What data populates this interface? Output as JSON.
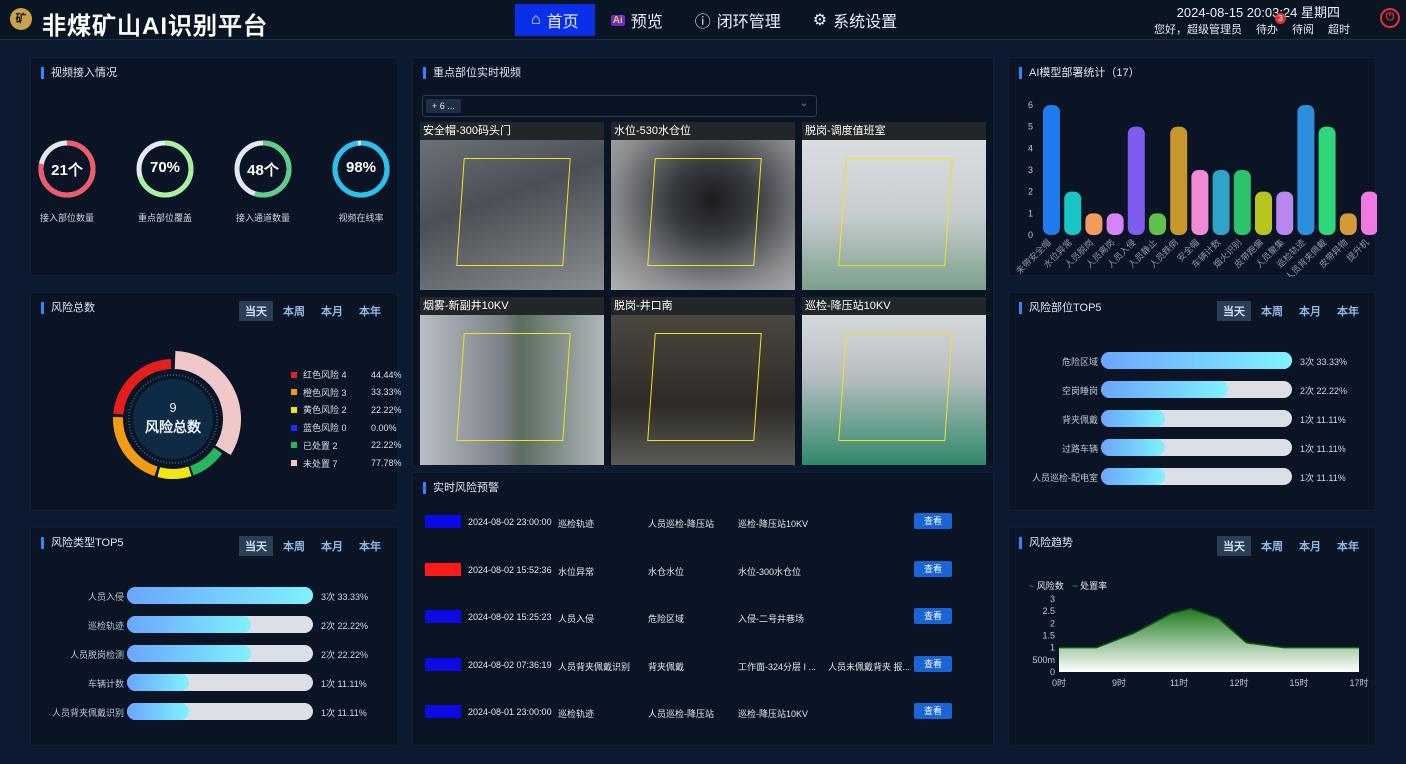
{
  "header": {
    "logo_text": "矿",
    "title": "非煤矿山AI识别平台",
    "nav": [
      {
        "label": "首页",
        "icon": "home-icon",
        "active": true
      },
      {
        "label": "预览",
        "icon": "ai-icon",
        "active": false
      },
      {
        "label": "闭环管理",
        "icon": "alert-icon",
        "active": false
      },
      {
        "label": "系统设置",
        "icon": "gear-icon",
        "active": false
      }
    ],
    "datetime": "2024-08-15 20:03:24 星期四",
    "greeting": "您好，超级管理员",
    "todo": "待办",
    "todo_badge": "3",
    "pending_read": "待阅",
    "overtime": "超时",
    "power_icon": "power-icon"
  },
  "video_access": {
    "title": "视频接入情况",
    "stats": [
      {
        "value": "21个",
        "label": "接入部位数量",
        "pct": 0.78,
        "color": "#ef5b6b"
      },
      {
        "value": "70%",
        "label": "重点部位覆盖",
        "pct": 0.7,
        "color": "#a6f0a0"
      },
      {
        "value": "48个",
        "label": "接入通道数量",
        "pct": 0.55,
        "color": "#5cd08a"
      },
      {
        "value": "98%",
        "label": "视频在线率",
        "pct": 0.98,
        "color": "#28c1f0"
      }
    ]
  },
  "risk_total": {
    "title": "风险总数",
    "tabs": [
      "当天",
      "本周",
      "本月",
      "本年"
    ],
    "active_tab": "当天",
    "center_value": "9",
    "center_label": "风险总数",
    "legend": [
      {
        "label": "红色风险 4",
        "pct": "44.44%",
        "color": "#e51d1d",
        "value": 4
      },
      {
        "label": "橙色风险 3",
        "pct": "33.33%",
        "color": "#f39c12",
        "value": 3
      },
      {
        "label": "黄色风险 2",
        "pct": "22.22%",
        "color": "#f5e50f",
        "value": 2
      },
      {
        "label": "蓝色风险 0",
        "pct": "0.00%",
        "color": "#1a2bff",
        "value": 0
      },
      {
        "label": "已处置 2",
        "pct": "22.22%",
        "color": "#27b55e",
        "value": 2
      },
      {
        "label": "未处置 7",
        "pct": "77.78%",
        "color": "#f0c8c8",
        "value": 7
      }
    ]
  },
  "risk_type_top5": {
    "title": "风险类型TOP5",
    "tabs": [
      "当天",
      "本周",
      "本月",
      "本年"
    ],
    "active_tab": "当天",
    "items": [
      {
        "label": "人员入侵",
        "count": "3次",
        "pct": "33.33%",
        "fill": 1.0
      },
      {
        "label": "巡检轨迹",
        "count": "2次",
        "pct": "22.22%",
        "fill": 0.667
      },
      {
        "label": "人员脱岗检测",
        "count": "2次",
        "pct": "22.22%",
        "fill": 0.667
      },
      {
        "label": "车辆计数",
        "count": "1次",
        "pct": "11.11%",
        "fill": 0.333
      },
      {
        "label": "人员背夹佩戴识别",
        "count": "1次",
        "pct": "11.11%",
        "fill": 0.333
      }
    ]
  },
  "key_video": {
    "title": "重点部位实时视频",
    "select_value": "+ 6 ...",
    "chevron_icon": "chevron-down-icon",
    "videos": [
      {
        "title": "安全帽-300码头门",
        "scene": "mine-shaft"
      },
      {
        "title": "水位-530水仓位",
        "scene": "tunnel"
      },
      {
        "title": "脱岗-调度值班室",
        "scene": "control-room"
      },
      {
        "title": "烟雾-新副井10KV",
        "scene": "switch-room"
      },
      {
        "title": "脱岗-井口南",
        "scene": "cage"
      },
      {
        "title": "巡检-降压站10KV",
        "scene": "substation"
      }
    ]
  },
  "realtime_alerts": {
    "title": "实时风险预警",
    "button_label": "查看",
    "rows": [
      {
        "color": "#0a0ae6",
        "time": "2024-08-02 23:00:00",
        "type": "巡检轨迹",
        "area": "人员巡检-降压站",
        "location": "巡检-降压站10KV",
        "extra": ""
      },
      {
        "color": "#ff1a1a",
        "time": "2024-08-02 15:52:36",
        "type": "水位异常",
        "area": "水仓水位",
        "location": "水位-300水仓位",
        "extra": ""
      },
      {
        "color": "#0a0ae6",
        "time": "2024-08-02 15:25:23",
        "type": "人员入侵",
        "area": "危险区域",
        "location": "入侵-二号井巷场",
        "extra": ""
      },
      {
        "color": "#0a0ae6",
        "time": "2024-08-02 07:36:19",
        "type": "人员背夹佩戴识别",
        "area": "背夹佩戴",
        "location": "工作面-324分层 I ...",
        "extra": "人员未佩戴背夹 报..."
      },
      {
        "color": "#0a0ae6",
        "time": "2024-08-01 23:00:00",
        "type": "巡检轨迹",
        "area": "人员巡检-降压站",
        "location": "巡检-降压站10KV",
        "extra": ""
      }
    ]
  },
  "ai_model": {
    "title": "AI模型部署统计（17）"
  },
  "chart_data": [
    {
      "type": "bar",
      "title": "AI模型部署统计（17）",
      "categories": [
        "未带安全帽",
        "水位异常",
        "人员脱岗",
        "人员离岗",
        "人员入侵",
        "人员静止",
        "人员跌倒",
        "安全帽",
        "车辆计数",
        "烟火识别",
        "皮带跑偏",
        "人员聚集",
        "巡检轨迹",
        "人员背夹佩戴",
        "皮带异物",
        "提升机"
      ],
      "values": [
        6,
        2,
        1,
        1,
        5,
        1,
        5,
        3,
        3,
        3,
        2,
        2,
        6,
        5,
        1,
        2
      ],
      "colors": [
        "#1e7bf0",
        "#19c6c6",
        "#f39c5a",
        "#d883f5",
        "#7f5cf0",
        "#5fc14a",
        "#c9962c",
        "#f08ad6",
        "#2fa4c8",
        "#2bc46a",
        "#b6c41e",
        "#b887f0",
        "#2c8fe0",
        "#2fd67a",
        "#d49a3a",
        "#f07ae0"
      ],
      "ylim": [
        0,
        6
      ],
      "yticks": [
        0,
        1,
        2,
        3,
        4,
        5,
        6
      ]
    },
    {
      "type": "area",
      "title": "风险趋势",
      "series": [
        {
          "name": "风险数"
        },
        {
          "name": "处置率"
        }
      ],
      "x_ticks": [
        "0时",
        "9时",
        "11时",
        "12时",
        "15时",
        "17时"
      ],
      "y_ticks": [
        "0",
        "500m",
        "1",
        "1.5",
        "2",
        "2.5",
        "3"
      ],
      "ylim": [
        0,
        3
      ],
      "points": [
        [
          0,
          1
        ],
        [
          2,
          1
        ],
        [
          4,
          1.6
        ],
        [
          6,
          2.4
        ],
        [
          7,
          2.6
        ],
        [
          8.5,
          2.2
        ],
        [
          10,
          1.2
        ],
        [
          12,
          1
        ],
        [
          16,
          1
        ]
      ]
    }
  ],
  "risk_location_top5": {
    "title": "风险部位TOP5",
    "tabs": [
      "当天",
      "本周",
      "本月",
      "本年"
    ],
    "active_tab": "当天",
    "items": [
      {
        "label": "危险区域",
        "count": "3次",
        "pct": "33.33%",
        "fill": 1.0
      },
      {
        "label": "空岗睡岗",
        "count": "2次",
        "pct": "22.22%",
        "fill": 0.667
      },
      {
        "label": "背夹佩戴",
        "count": "1次",
        "pct": "11.11%",
        "fill": 0.333
      },
      {
        "label": "过路车辆",
        "count": "1次",
        "pct": "11.11%",
        "fill": 0.333
      },
      {
        "label": "人员巡检-配电室",
        "count": "1次",
        "pct": "11.11%",
        "fill": 0.333
      }
    ]
  },
  "risk_trend": {
    "title": "风险趋势",
    "tabs": [
      "当天",
      "本周",
      "本月",
      "本年"
    ],
    "active_tab": "当天",
    "legend": [
      "风险数",
      "处置率"
    ]
  }
}
